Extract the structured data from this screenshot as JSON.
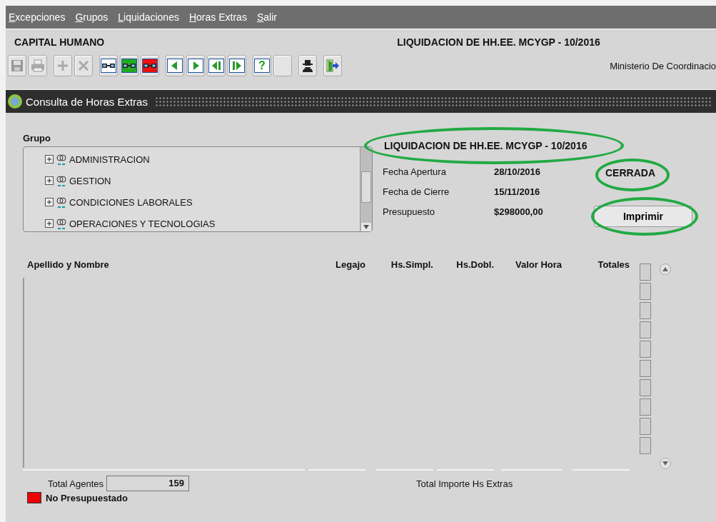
{
  "menu": [
    {
      "label": "Excepciones"
    },
    {
      "label": "Grupos"
    },
    {
      "label": "Liquidaciones"
    },
    {
      "label": "Horas Extras"
    },
    {
      "label": "Salir"
    }
  ],
  "header": {
    "app_title": "CAPITAL HUMANO",
    "liquidacion_title": "LIQUIDACION DE HH.EE. MCYGP - 10/2016",
    "organization": "Ministerio De Coordinacio"
  },
  "toolbar": [
    {
      "kind": "save",
      "disabled": true
    },
    {
      "kind": "print",
      "disabled": true
    },
    {
      "kind": "add",
      "disabled": true
    },
    {
      "kind": "delete",
      "disabled": true
    },
    {
      "kind": "glasses",
      "color": "#ffffff"
    },
    {
      "kind": "glasses",
      "color": "#22aa22"
    },
    {
      "kind": "glasses",
      "color": "#ee1111"
    },
    {
      "kind": "prev"
    },
    {
      "kind": "next"
    },
    {
      "kind": "first"
    },
    {
      "kind": "last"
    },
    {
      "kind": "help",
      "label": "?"
    },
    {
      "kind": "blank"
    },
    {
      "kind": "spy"
    },
    {
      "kind": "exit"
    }
  ],
  "form_title": "Consulta de Horas Extras",
  "grupo": {
    "label": "Grupo",
    "items": [
      {
        "label": "ADMINISTRACION",
        "expanded": false
      },
      {
        "label": "GESTION",
        "expanded": false
      },
      {
        "label": "CONDICIONES LABORALES",
        "expanded": false
      },
      {
        "label": "OPERACIONES Y TECNOLOGIAS",
        "expanded": false
      }
    ]
  },
  "liquidacion": {
    "title": "LIQUIDACION DE HH.EE. MCYGP - 10/2016",
    "title_highlighted": true,
    "fields": [
      {
        "label": "Fecha Apertura",
        "value": "28/10/2016"
      },
      {
        "label": "Fecha de Cierre",
        "value": "15/11/2016"
      },
      {
        "label": "Presupuesto",
        "value": "$298000,00"
      }
    ],
    "status": "CERRADA",
    "status_highlighted": true,
    "print_button": "Imprimir",
    "print_highlighted": true
  },
  "table": {
    "columns": [
      "Apellido y Nombre",
      "Legajo",
      "Hs.Simpl.",
      "Hs.Dobl.",
      "Valor Hora",
      "Totales"
    ],
    "rows": [
      {
        "checked": false
      },
      {
        "checked": false
      },
      {
        "checked": false
      },
      {
        "checked": false
      },
      {
        "checked": false
      },
      {
        "checked": false
      },
      {
        "checked": false
      },
      {
        "checked": false
      },
      {
        "checked": false
      },
      {
        "checked": false
      }
    ]
  },
  "footer": {
    "total_agentes_label": "Total Agentes",
    "total_agentes": "159",
    "total_importe_label": "Total Importe Hs Extras",
    "legend": [
      {
        "label": "No Presupuestado",
        "color": "#ee0000"
      }
    ]
  }
}
